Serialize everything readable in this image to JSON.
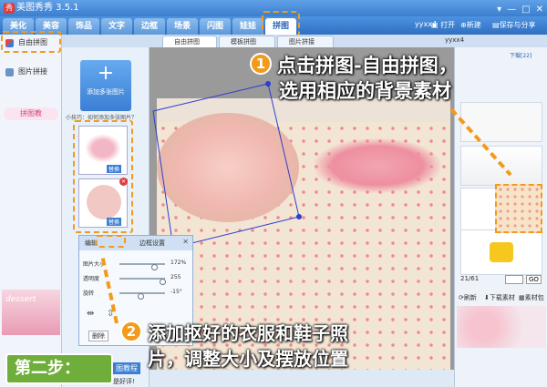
{
  "title": "美图秀秀 3.5.1",
  "menu": {
    "tabs": [
      "美化",
      "美容",
      "饰品",
      "文字",
      "边框",
      "场景",
      "闪图",
      "娃娃",
      "拼图"
    ]
  },
  "toolbar": {
    "user": "yyxx4",
    "open": "打开",
    "new": "新建",
    "save": "保存与分享"
  },
  "sidebar": {
    "items": [
      "自由拼图",
      "图片拼接"
    ],
    "promo_text": "拼图教",
    "promo_left": "dessert"
  },
  "subtabs": [
    "自由拼图",
    "模板拼图",
    "图片拼接"
  ],
  "subtab_user": "yyxx4",
  "tools": {
    "add_label": "添加多张图片",
    "tip": "小技巧：如何添加多张图片？",
    "replace": "替换"
  },
  "dialog": {
    "tab1": "编辑",
    "tab2": "边框设置",
    "rows": [
      {
        "label": "图片大小",
        "value": "172%",
        "level": 0.8
      },
      {
        "label": "透明度",
        "value": "255",
        "level": 1.0
      },
      {
        "label": "旋转",
        "value": "-15°",
        "level": 0.45
      }
    ],
    "delete_label": "删除"
  },
  "right": {
    "download_label": "下载[22]",
    "page": "21/61",
    "go": "GO",
    "refresh": "刷新",
    "download_more": "下载素材",
    "material": "素材包"
  },
  "annotations": {
    "step1_num": "1",
    "step1_line1": "点击拼图-自由拼图，",
    "step1_line2": "选用相应的背景素材",
    "step2_num": "2",
    "step2_line1": "添加抠好的衣服和鞋子照",
    "step2_line2": "片，调整大小及摆放位置",
    "step_badge": "第二步：",
    "bottom_btn": "图教程",
    "bottom_note": "是好评!"
  }
}
